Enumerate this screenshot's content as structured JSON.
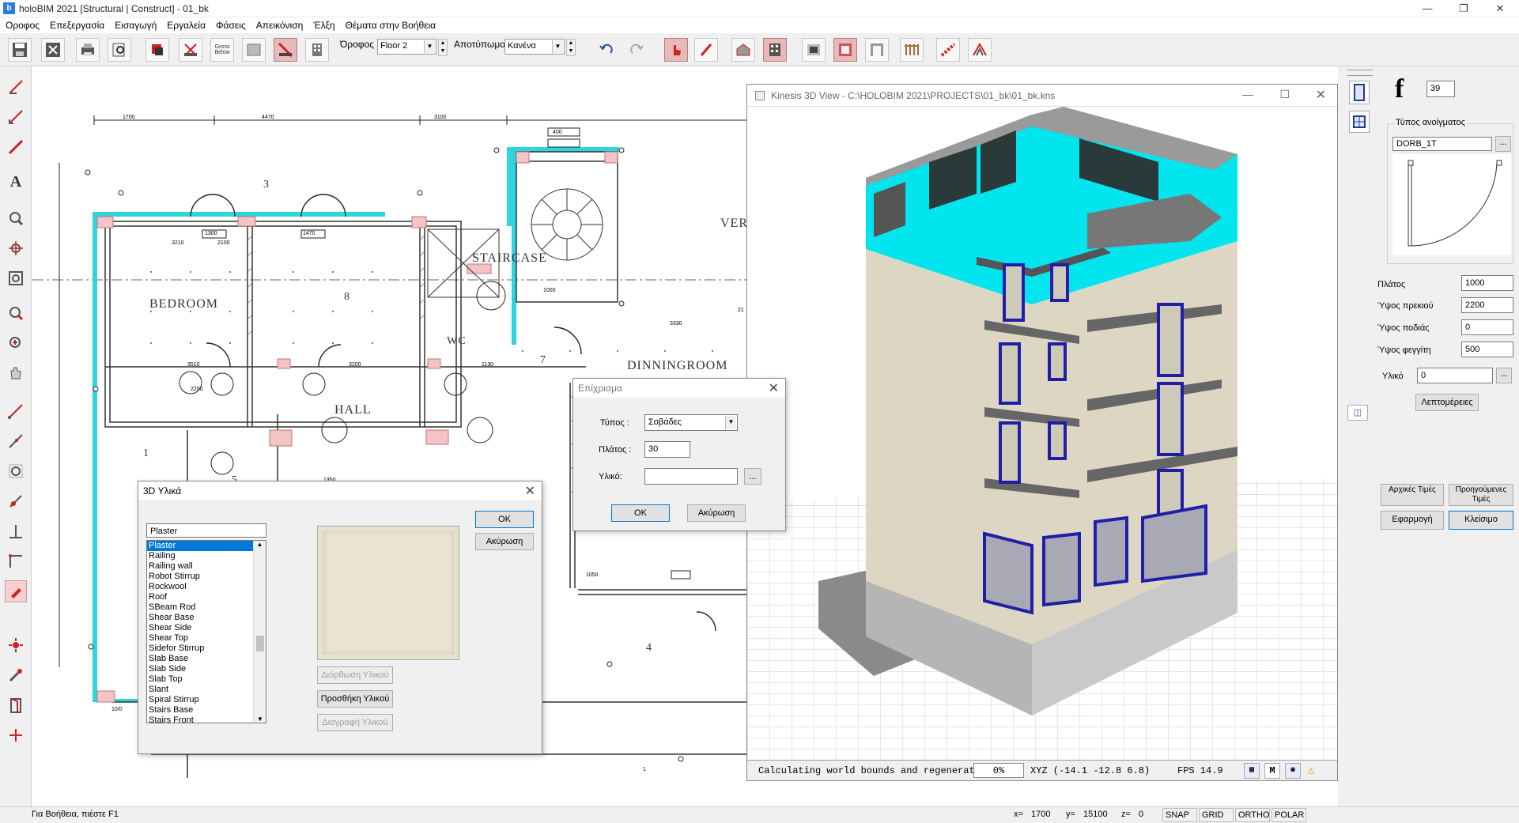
{
  "window": {
    "title": "holoBIM 2021 [Structural | Construct] - 01_bk",
    "icon": "b"
  },
  "menu": [
    "Οροφος",
    "Επεξεργασία",
    "Εισαγωγή",
    "Εργαλεία",
    "Φάσεις",
    "Απεικόνιση",
    "Έλξη",
    "Θέματα στην Βοήθεια"
  ],
  "toolbar": {
    "floor_label": "Όροφος",
    "floor_value": "Floor 2",
    "print_label": "Αποτύπωμα",
    "print_value": "Κανένα",
    "gross_label": "Gross Below"
  },
  "plan": {
    "rooms": [
      "BEDROOM",
      "STAIRCASE",
      "HALL",
      "WC",
      "DINNINGROOM",
      "VER"
    ],
    "numbers": [
      "3",
      "8",
      "1",
      "5",
      "7",
      "4"
    ],
    "dims": [
      "1700",
      "4470",
      "3100",
      "1300",
      "1470",
      "3210",
      "2100",
      "3510",
      "3200",
      "1000",
      "2200",
      "400",
      "3330",
      "1130",
      "1350",
      "1050",
      "10/0",
      "21",
      "1"
    ]
  },
  "dlg_materials": {
    "title": "3D Υλικά",
    "search_value": "Plaster",
    "items": [
      "Plaster",
      "Railing",
      "Railing wall",
      "Robot Stirrup",
      "Rockwool",
      "Roof",
      "SBeam Rod",
      "Shear Base",
      "Shear Side",
      "Shear Top",
      "Sidefor Stirrup",
      "Slab Base",
      "Slab Side",
      "Slab Top",
      "Slant",
      "Spiral Stirrup",
      "Stairs Base",
      "Stairs Front"
    ],
    "selected": "Plaster",
    "ok": "OK",
    "cancel": "Ακύρωση",
    "edit": "Διόρθωση Υλικού",
    "add": "Προσθήκη Υλικού",
    "delete": "Διαγραφή Υλικού",
    "swatch_color": "#e6e1cd"
  },
  "dlg_plaster": {
    "title": "Επίχρισμα",
    "type_label": "Τύπος :",
    "type_value": "Σοβάδες",
    "width_label": "Πλάτος :",
    "width_value": "30",
    "material_label": "Υλικό:",
    "material_value": "",
    "browse": "...",
    "ok": "OK",
    "cancel": "Ακύρωση"
  },
  "view3d": {
    "title": "Kinesis 3D View - C:\\HOLOBIM 2021\\PROJECTS\\01_bk\\01_bk.kns",
    "status_text": "Calculating world bounds and regenerati.",
    "percent": "0%",
    "xyz": "XYZ (-14.1 -12.8 6.8)",
    "fps": "FPS 14.9",
    "m_btn": "M",
    "colors": {
      "top_floor": "#00e5ee",
      "walls": "#dcd6c2",
      "frames": "#1e1ea8",
      "base": "#cfcfcf"
    }
  },
  "right": {
    "big_letter": "f",
    "number_value": "39",
    "opening_type_label": "Τύπος ανοίγματος",
    "opening_type_value": "DORB_1T",
    "browse": "...",
    "width_label": "Πλάτος",
    "width_value": "1000",
    "lintel_label": "Ύψος πρεκιού",
    "lintel_value": "2200",
    "sill_label": "Ύψος ποδιάς",
    "sill_value": "0",
    "light_label": "Ύψος φεγγίτη",
    "light_value": "500",
    "material_label": "Υλικό",
    "material_value": "0",
    "details": "Λεπτομέρειες",
    "initial": "Αρχικές Τιμές",
    "previous": "Προηγούμενες Τιμές",
    "apply": "Εφαρμογή",
    "close": "Κλείσιμο"
  },
  "status": {
    "help": "Για Βοήθεια, πιέστε F1",
    "x_label": "x=",
    "x": "1700",
    "y_label": "y=",
    "y": "15100",
    "z_label": "z=",
    "z": "0",
    "snap": "SNAP",
    "grid": "GRID",
    "ortho": "ORTHO",
    "polar": "POLAR"
  }
}
